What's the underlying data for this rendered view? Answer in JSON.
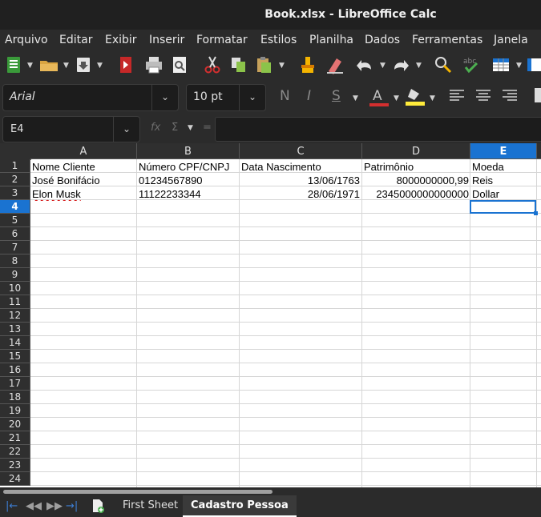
{
  "window": {
    "title": "Book.xlsx - LibreOffice Calc"
  },
  "menu": [
    "Arquivo",
    "Editar",
    "Exibir",
    "Inserir",
    "Formatar",
    "Estilos",
    "Planilha",
    "Dados",
    "Ferramentas",
    "Janela"
  ],
  "format_bar": {
    "font_name": "Arial",
    "font_size": "10 pt",
    "bold": "N",
    "italic": "I",
    "underline": "S",
    "font_color": "A"
  },
  "formula_bar": {
    "cell_ref": "E4",
    "fx": "fx",
    "sigma": "Σ",
    "equals": "=",
    "value": ""
  },
  "sheet": {
    "columns": [
      "A",
      "B",
      "C",
      "D",
      "E"
    ],
    "selected_column": "E",
    "selected_row": 4,
    "rows": [
      "1",
      "2",
      "3",
      "4",
      "5",
      "6",
      "7",
      "8",
      "9",
      "10",
      "11",
      "12",
      "13",
      "14",
      "15",
      "16",
      "17",
      "18",
      "19",
      "20",
      "21",
      "22",
      "23",
      "24"
    ],
    "data": [
      [
        "Nome Cliente",
        "Número CPF/CNPJ",
        "Data Nascimento",
        "Patrimônio",
        "Moeda"
      ],
      [
        "José Bonifácio",
        "01234567890",
        "13/06/1763",
        "8000000000,99",
        "Reis"
      ],
      [
        "Elon Musk",
        "11122233344",
        "28/06/1971",
        "2345000000000000",
        "Dollar"
      ]
    ]
  },
  "tabs": {
    "first": "First Sheet",
    "second": "Cadastro Pessoa",
    "active": "Cadastro Pessoa"
  },
  "colors": {
    "accent": "#1a73d1",
    "grid_line": "#d6d6d6",
    "header_bg": "#2f2f2f"
  }
}
